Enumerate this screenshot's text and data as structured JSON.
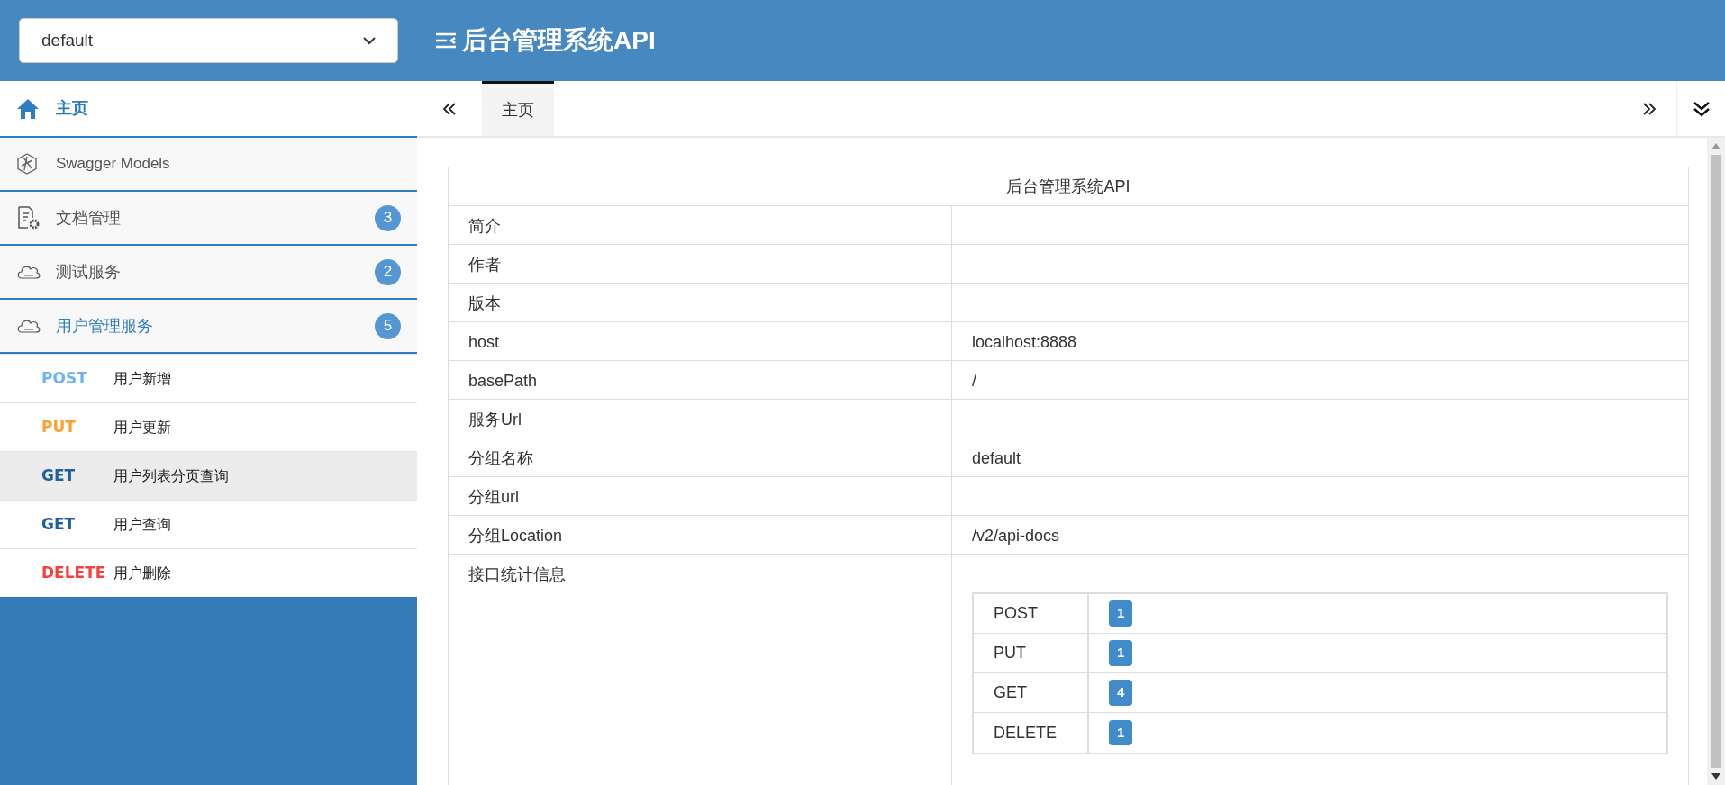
{
  "header": {
    "group_select": {
      "value": "default"
    },
    "title": "后台管理系统API"
  },
  "sidebar": {
    "items": [
      {
        "kind": "home",
        "label": "主页",
        "selected": true,
        "expanded": false
      },
      {
        "kind": "models",
        "label": "Swagger Models",
        "selected": false,
        "expanded": false
      },
      {
        "kind": "docs",
        "label": "文档管理",
        "count": "3",
        "selected": false,
        "expanded": false
      },
      {
        "kind": "api",
        "label": "测试服务",
        "count": "2",
        "selected": false,
        "expanded": false
      },
      {
        "kind": "api",
        "label": "用户管理服务",
        "count": "5",
        "selected": false,
        "expanded": true,
        "children": [
          {
            "method": "POST",
            "color": "#6cb2f7",
            "label": "用户新增",
            "selected": false
          },
          {
            "method": "PUT",
            "color": "#fca130",
            "label": "用户更新",
            "selected": false
          },
          {
            "method": "GET",
            "color": "#1f5f9f",
            "label": "用户列表分页查询",
            "selected": true
          },
          {
            "method": "GET",
            "color": "#1f5f9f",
            "label": "用户查询",
            "selected": false
          },
          {
            "method": "DELETE",
            "color": "#f93e3e",
            "label": "用户删除",
            "selected": false
          }
        ]
      }
    ]
  },
  "tabs": [
    {
      "label": "主页",
      "selected": true
    }
  ],
  "info_table": {
    "title": "后台管理系统API",
    "rows": [
      {
        "kind": "text",
        "label": "简介"
      },
      {
        "kind": "text",
        "label": "作者"
      },
      {
        "kind": "text",
        "label": "版本"
      },
      {
        "kind": "text",
        "label": "host",
        "value": "localhost:8888"
      },
      {
        "kind": "text",
        "label": "basePath",
        "value": "/"
      },
      {
        "kind": "text",
        "label": "服务Url"
      },
      {
        "kind": "text",
        "label": "分组名称",
        "value": "default"
      },
      {
        "kind": "text",
        "label": "分组url"
      },
      {
        "kind": "text",
        "label": "分组Location",
        "value": "/v2/api-docs"
      },
      {
        "kind": "stats",
        "label": "接口统计信息",
        "stats": [
          {
            "method": "POST",
            "count": "1"
          },
          {
            "method": "PUT",
            "count": "1"
          },
          {
            "method": "GET",
            "count": "4"
          },
          {
            "method": "DELETE",
            "count": "1"
          }
        ]
      }
    ]
  }
}
